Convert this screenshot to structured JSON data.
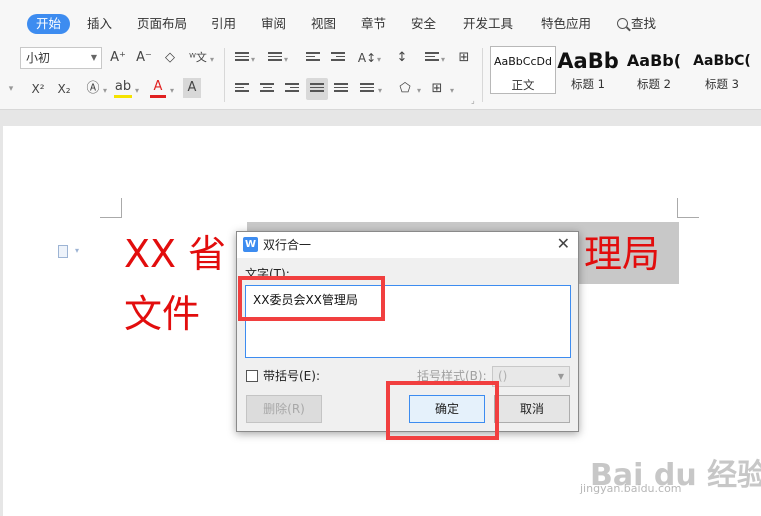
{
  "menu": {
    "tabs": [
      "开始",
      "插入",
      "页面布局",
      "引用",
      "审阅",
      "视图",
      "章节",
      "安全",
      "开发工具",
      "特色应用"
    ],
    "search_label": "查找"
  },
  "toolbar": {
    "font_size": "小初",
    "increase_font": "A⁺",
    "decrease_font": "A⁻",
    "superscript": "X²",
    "subscript": "X₂",
    "font_color_label": "A",
    "char_shade_label": "A",
    "highlight_label": "ab"
  },
  "styles": {
    "previews": [
      "AaBbCcDd",
      "AaBb",
      "AaBb(",
      "AaBbC("
    ],
    "labels": [
      "正文",
      "标题 1",
      "标题 2",
      "标题 3"
    ]
  },
  "document": {
    "line1_left": "XX 省",
    "line1_right": "理局",
    "line2": "文件",
    "text_color": "#e20d0d"
  },
  "dialog": {
    "title": "双行合一",
    "text_label": "文字(T):",
    "text_value": "XX委员会XX管理局",
    "bracket_checkbox_label": "带括号(E):",
    "bracket_style_label": "括号样式(B):",
    "bracket_style_value": "()",
    "delete_button": "删除(R)",
    "ok_button": "确定",
    "cancel_button": "取消",
    "accent": "#3d8cf0"
  },
  "watermark": {
    "logo": "Bai du 经验",
    "url": "jingyan.baidu.com"
  }
}
